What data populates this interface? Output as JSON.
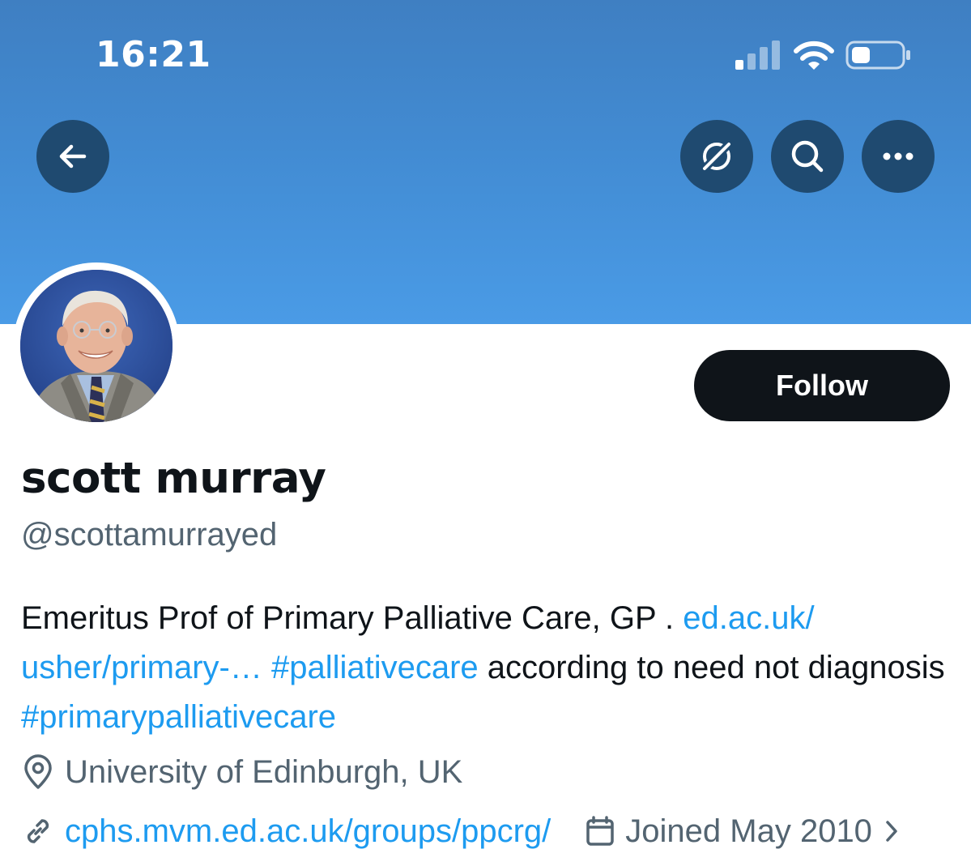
{
  "status_bar": {
    "time": "16:21",
    "icons": [
      "cellular-signal-icon",
      "wifi-icon",
      "battery-icon"
    ]
  },
  "header": {
    "buttons": [
      {
        "name": "back-button",
        "icon": "arrow-left-icon"
      },
      {
        "name": "grok-button",
        "icon": "grok-icon"
      },
      {
        "name": "search-button",
        "icon": "search-icon"
      },
      {
        "name": "more-button",
        "icon": "more-horizontal-icon"
      }
    ],
    "banner_color": "#4a9be6"
  },
  "profile": {
    "follow_label": "Follow",
    "display_name": "scott murray",
    "handle": "@scottamurrayed",
    "bio": {
      "text_1": "Emeritus Prof of Primary Palliative Care, GP . ",
      "link": "ed.ac.uk/ usher/primary-…",
      "hashtag_1": "#palliativecare",
      "text_2": " according to need not diagnosis ",
      "hashtag_2": "#primarypalliativecare"
    },
    "location": "University of Edinburgh, UK",
    "website": "cphs.mvm.ed.ac.uk/groups/ppcrg/",
    "joined": "Joined May 2010"
  },
  "colors": {
    "link": "#1d9bf0",
    "secondary_text": "#536471",
    "primary_text": "#0f1419",
    "nav_button": "#1f4a70"
  }
}
